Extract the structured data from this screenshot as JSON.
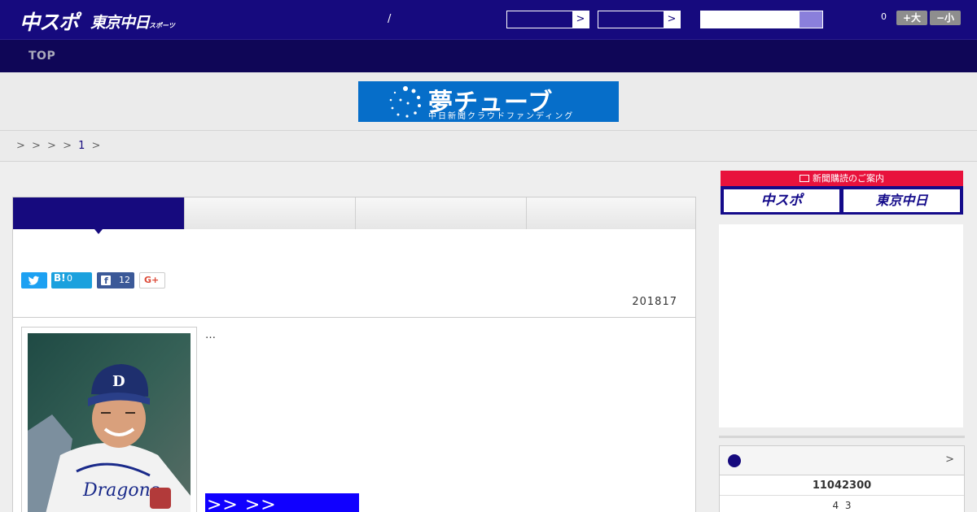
{
  "header": {
    "logo_chuspo": "中スポ",
    "logo_tokyo": "東京中日",
    "logo_tokyo_sub": "スポーツ",
    "slash": "/",
    "select1_arrow": ">",
    "select2_arrow": ">",
    "zoom_level": "0",
    "zoom_in_label": "+大",
    "zoom_out_label": "−小"
  },
  "nav": {
    "top_label": "TOP"
  },
  "banner": {
    "title": "夢チューブ",
    "subtitle": "中日新聞クラウドファンディング"
  },
  "breadcrumb": {
    "separators": "> > > >",
    "current": "1",
    "trail": ">"
  },
  "article": {
    "share": {
      "twitter_icon": "twitter-icon",
      "hatena_label": "B!",
      "hatena_count": "0",
      "facebook_count": "12",
      "gplus_label": "G+"
    },
    "date": "201817",
    "ellipsis": "…",
    "read_more": ">> >>"
  },
  "sidebar": {
    "subscribe_title": "新聞購読のご案内",
    "subscribe_chuspo": "中スポ",
    "subscribe_tokyo": "東京中日",
    "scores_chevron": ">",
    "scores_row1": "11042300",
    "scores_row2": "4  3"
  },
  "colors": {
    "header_bg": "#160a7e",
    "nav_bg": "#0f0657",
    "banner_bg": "#066ec9",
    "accent_red": "#e8123c",
    "read_more_bg": "#1000ff"
  }
}
